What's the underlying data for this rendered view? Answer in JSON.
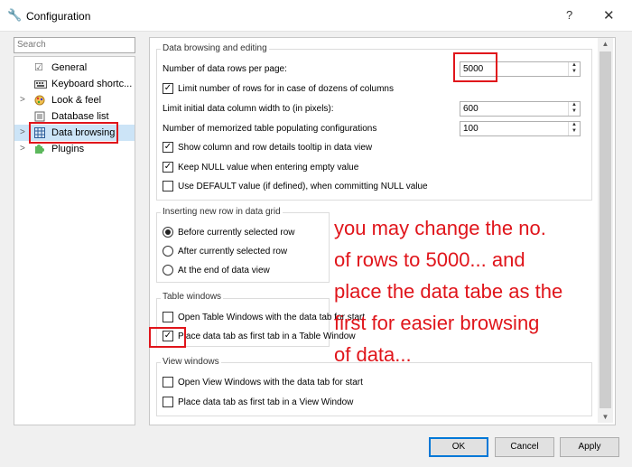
{
  "window": {
    "title": "Configuration",
    "help_label": "?",
    "close_label": "✕"
  },
  "sidebar": {
    "search_placeholder": "Search",
    "items": [
      {
        "label": "General",
        "expander": ""
      },
      {
        "label": "Keyboard shortc...",
        "expander": ""
      },
      {
        "label": "Look & feel",
        "expander": ">"
      },
      {
        "label": "Database list",
        "expander": ""
      },
      {
        "label": "Data browsing",
        "expander": ">"
      },
      {
        "label": "Plugins",
        "expander": ">"
      }
    ]
  },
  "groups": {
    "data_browsing": {
      "title": "Data browsing and editing",
      "rows_per_page_label": "Number of data rows per page:",
      "rows_per_page_value": "5000",
      "limit_rows_label": "Limit number of rows for in case of dozens of columns",
      "column_width_label": "Limit initial data column width to (in pixels):",
      "column_width_value": "600",
      "memorized_label": "Number of memorized table populating configurations",
      "memorized_value": "100",
      "tooltip_label": "Show column and row details tooltip in data view",
      "keep_null_label": "Keep NULL value when entering empty value",
      "use_default_label": "Use DEFAULT value (if defined), when committing NULL value"
    },
    "insert_row": {
      "title": "Inserting new row in data grid",
      "before_label": "Before currently selected row",
      "after_label": "After currently selected row",
      "end_label": "At the end of data view"
    },
    "table_windows": {
      "title": "Table windows",
      "open_data_tab_label": "Open Table Windows with the data tab for start",
      "place_first_label": "Place data tab as first tab in a Table Window"
    },
    "view_windows": {
      "title": "View windows",
      "open_data_tab_label": "Open View Windows with the data tab for start",
      "place_first_label": "Place data tab as first tab in a View Window"
    }
  },
  "annotation": {
    "lines": [
      "you may change the no.",
      "of rows to 5000... and",
      "place the data tabe as the",
      "first for easier browsing",
      "of data..."
    ]
  },
  "buttons": {
    "ok": "OK",
    "cancel": "Cancel",
    "apply": "Apply"
  },
  "colors": {
    "annotation_red": "#e0151b",
    "selection": "#cce4f7",
    "default_button_border": "#0078d7"
  }
}
